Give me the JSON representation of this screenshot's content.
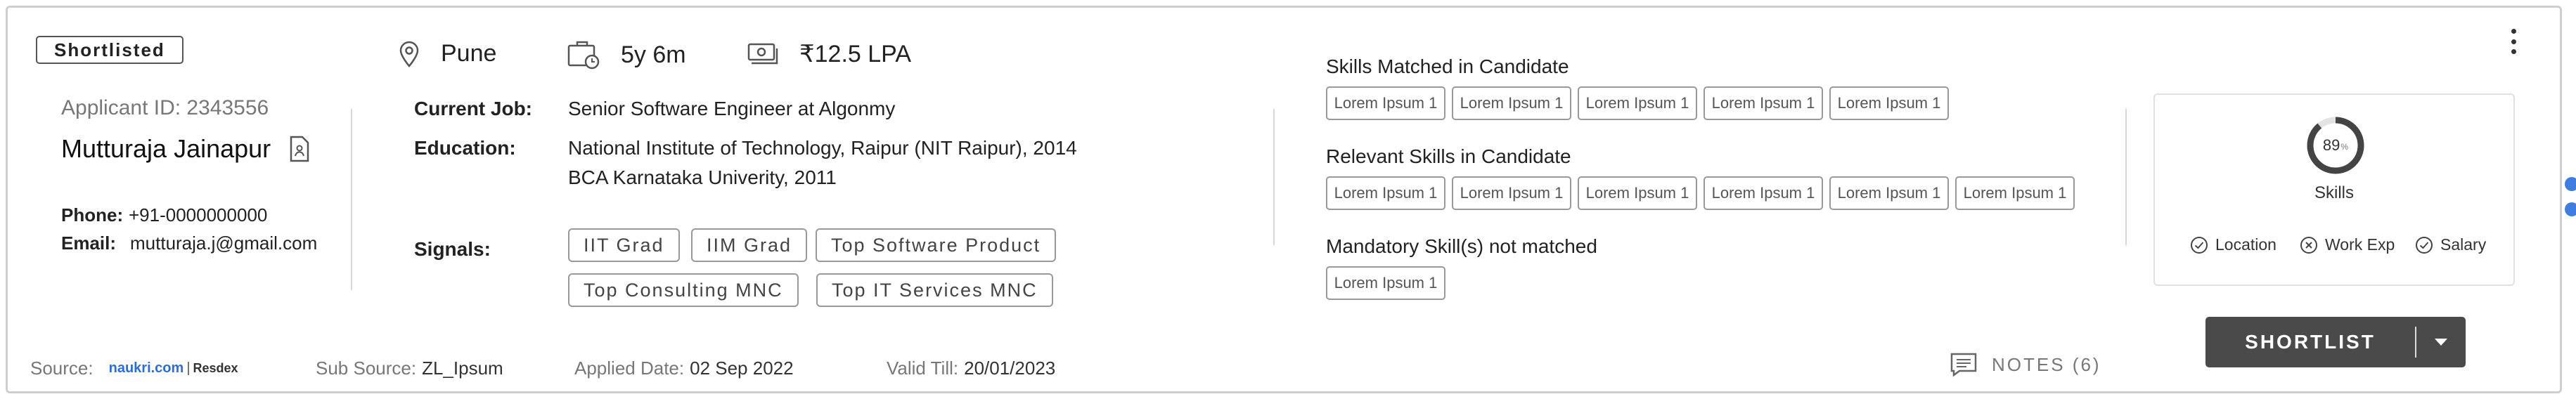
{
  "candidate": {
    "status": "Shortlisted",
    "applicant_id": "Applicant ID: 2343556",
    "name": "Mutturaja Jainapur",
    "phone_label": "Phone:",
    "phone": "+91-0000000000",
    "email_label": "Email:",
    "email": "mutturaja.j@gmail.com"
  },
  "stats": {
    "location": "Pune",
    "experience": "5y 6m",
    "salary": "₹12.5 LPA",
    "location_icon": "map-pin-icon",
    "experience_icon": "briefcase-clock-icon",
    "salary_icon": "money-icon"
  },
  "details": {
    "current_job_label": "Current Job:",
    "current_job": "Senior Software Engineer at Algonmy",
    "education_label": "Education:",
    "education": [
      "National Institute of Technology, Raipur (NIT Raipur), 2014",
      "BCA Karnataka Univerity, 2011"
    ],
    "signals_label": "Signals:",
    "signals": [
      "IIT Grad",
      "IIM Grad",
      "Top Software Product",
      "Top Consulting MNC",
      "Top IT Services MNC"
    ]
  },
  "skills": {
    "matched_title": "Skills Matched in Candidate",
    "matched": [
      "Lorem Ipsum 1",
      "Lorem Ipsum 1",
      "Lorem Ipsum 1",
      "Lorem Ipsum 1",
      "Lorem Ipsum 1"
    ],
    "relevant_title": "Relevant Skills in Candidate",
    "relevant": [
      "Lorem Ipsum 1",
      "Lorem Ipsum 1",
      "Lorem Ipsum 1",
      "Lorem Ipsum 1",
      "Lorem Ipsum 1",
      "Lorem Ipsum 1"
    ],
    "mandatory_title": "Mandatory Skill(s) not matched",
    "mandatory": [
      "Lorem Ipsum 1"
    ]
  },
  "meta": {
    "source_label": "Source:",
    "source_logo_main": "naukri.com",
    "source_logo_sep": "|",
    "source_logo_sub": "Resdex",
    "sub_source_label": "Sub Source:",
    "sub_source": "ZL_Ipsum",
    "applied_label": "Applied Date:",
    "applied": "02 Sep 2022",
    "valid_label": "Valid Till:",
    "valid": "20/01/2023"
  },
  "notes": {
    "label": "NOTES (6)"
  },
  "score": {
    "percent": 89,
    "percent_text": "89",
    "percent_sign": "%",
    "label": "Skills",
    "criteria": [
      {
        "label": "Location",
        "status": "matched"
      },
      {
        "label": "Work Exp",
        "status": "not-matched"
      },
      {
        "label": "Salary",
        "status": "matched"
      }
    ]
  },
  "actions": {
    "shortlist": "SHORTLIST"
  },
  "colors": {
    "accent": "#3f7ee0",
    "button": "#4a4a4a",
    "gauge": "#444444",
    "gauge_track": "#e3e3e3"
  }
}
